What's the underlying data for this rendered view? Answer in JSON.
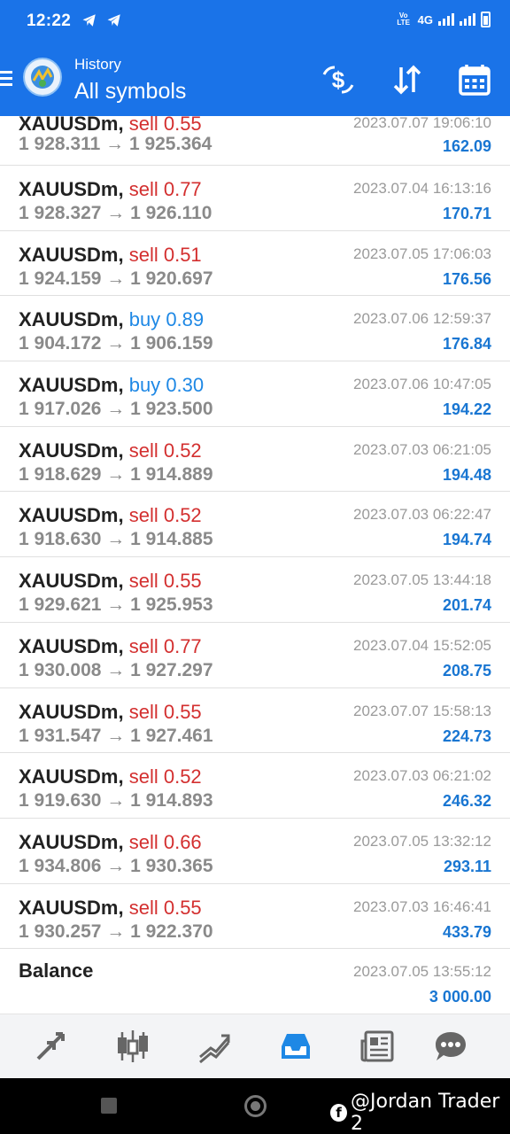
{
  "status_bar": {
    "time": "12:22",
    "network": "4G",
    "volte": "Vo LTE",
    "icons": [
      "telegram-icon",
      "telegram-icon",
      "signal-icon",
      "signal-icon",
      "battery-icon"
    ]
  },
  "header": {
    "subtitle": "History",
    "title": "All symbols",
    "actions": [
      "dollar-swap-icon",
      "sort-icon",
      "calendar-icon"
    ]
  },
  "colors": {
    "accent": "#1a73e8",
    "sell": "#d32f2f",
    "buy": "#1e88e5",
    "profit": "#1976d2"
  },
  "trades": [
    {
      "symbol": "XAUUSDm",
      "side": "sell",
      "volume": "0.55",
      "open": "1 928.311",
      "close": "1 925.364",
      "time": "2023.07.07 19:06:10",
      "profit": "162.09"
    },
    {
      "symbol": "XAUUSDm",
      "side": "sell",
      "volume": "0.77",
      "open": "1 928.327",
      "close": "1 926.110",
      "time": "2023.07.04 16:13:16",
      "profit": "170.71"
    },
    {
      "symbol": "XAUUSDm",
      "side": "sell",
      "volume": "0.51",
      "open": "1 924.159",
      "close": "1 920.697",
      "time": "2023.07.05 17:06:03",
      "profit": "176.56"
    },
    {
      "symbol": "XAUUSDm",
      "side": "buy",
      "volume": "0.89",
      "open": "1 904.172",
      "close": "1 906.159",
      "time": "2023.07.06 12:59:37",
      "profit": "176.84"
    },
    {
      "symbol": "XAUUSDm",
      "side": "buy",
      "volume": "0.30",
      "open": "1 917.026",
      "close": "1 923.500",
      "time": "2023.07.06 10:47:05",
      "profit": "194.22"
    },
    {
      "symbol": "XAUUSDm",
      "side": "sell",
      "volume": "0.52",
      "open": "1 918.629",
      "close": "1 914.889",
      "time": "2023.07.03 06:21:05",
      "profit": "194.48"
    },
    {
      "symbol": "XAUUSDm",
      "side": "sell",
      "volume": "0.52",
      "open": "1 918.630",
      "close": "1 914.885",
      "time": "2023.07.03 06:22:47",
      "profit": "194.74"
    },
    {
      "symbol": "XAUUSDm",
      "side": "sell",
      "volume": "0.55",
      "open": "1 929.621",
      "close": "1 925.953",
      "time": "2023.07.05 13:44:18",
      "profit": "201.74"
    },
    {
      "symbol": "XAUUSDm",
      "side": "sell",
      "volume": "0.77",
      "open": "1 930.008",
      "close": "1 927.297",
      "time": "2023.07.04 15:52:05",
      "profit": "208.75"
    },
    {
      "symbol": "XAUUSDm",
      "side": "sell",
      "volume": "0.55",
      "open": "1 931.547",
      "close": "1 927.461",
      "time": "2023.07.07 15:58:13",
      "profit": "224.73"
    },
    {
      "symbol": "XAUUSDm",
      "side": "sell",
      "volume": "0.52",
      "open": "1 919.630",
      "close": "1 914.893",
      "time": "2023.07.03 06:21:02",
      "profit": "246.32"
    },
    {
      "symbol": "XAUUSDm",
      "side": "sell",
      "volume": "0.66",
      "open": "1 934.806",
      "close": "1 930.365",
      "time": "2023.07.05 13:32:12",
      "profit": "293.11"
    },
    {
      "symbol": "XAUUSDm",
      "side": "sell",
      "volume": "0.55",
      "open": "1 930.257",
      "close": "1 922.370",
      "time": "2023.07.03 16:46:41",
      "profit": "433.79"
    }
  ],
  "balance": {
    "label": "Balance",
    "time": "2023.07.05 13:55:12",
    "amount": "3 000.00"
  },
  "bottom_nav": [
    "quotes-icon",
    "chart-icon",
    "trade-icon",
    "history-icon",
    "news-icon",
    "messages-icon"
  ],
  "watermark": "@Jordan Trader 2"
}
